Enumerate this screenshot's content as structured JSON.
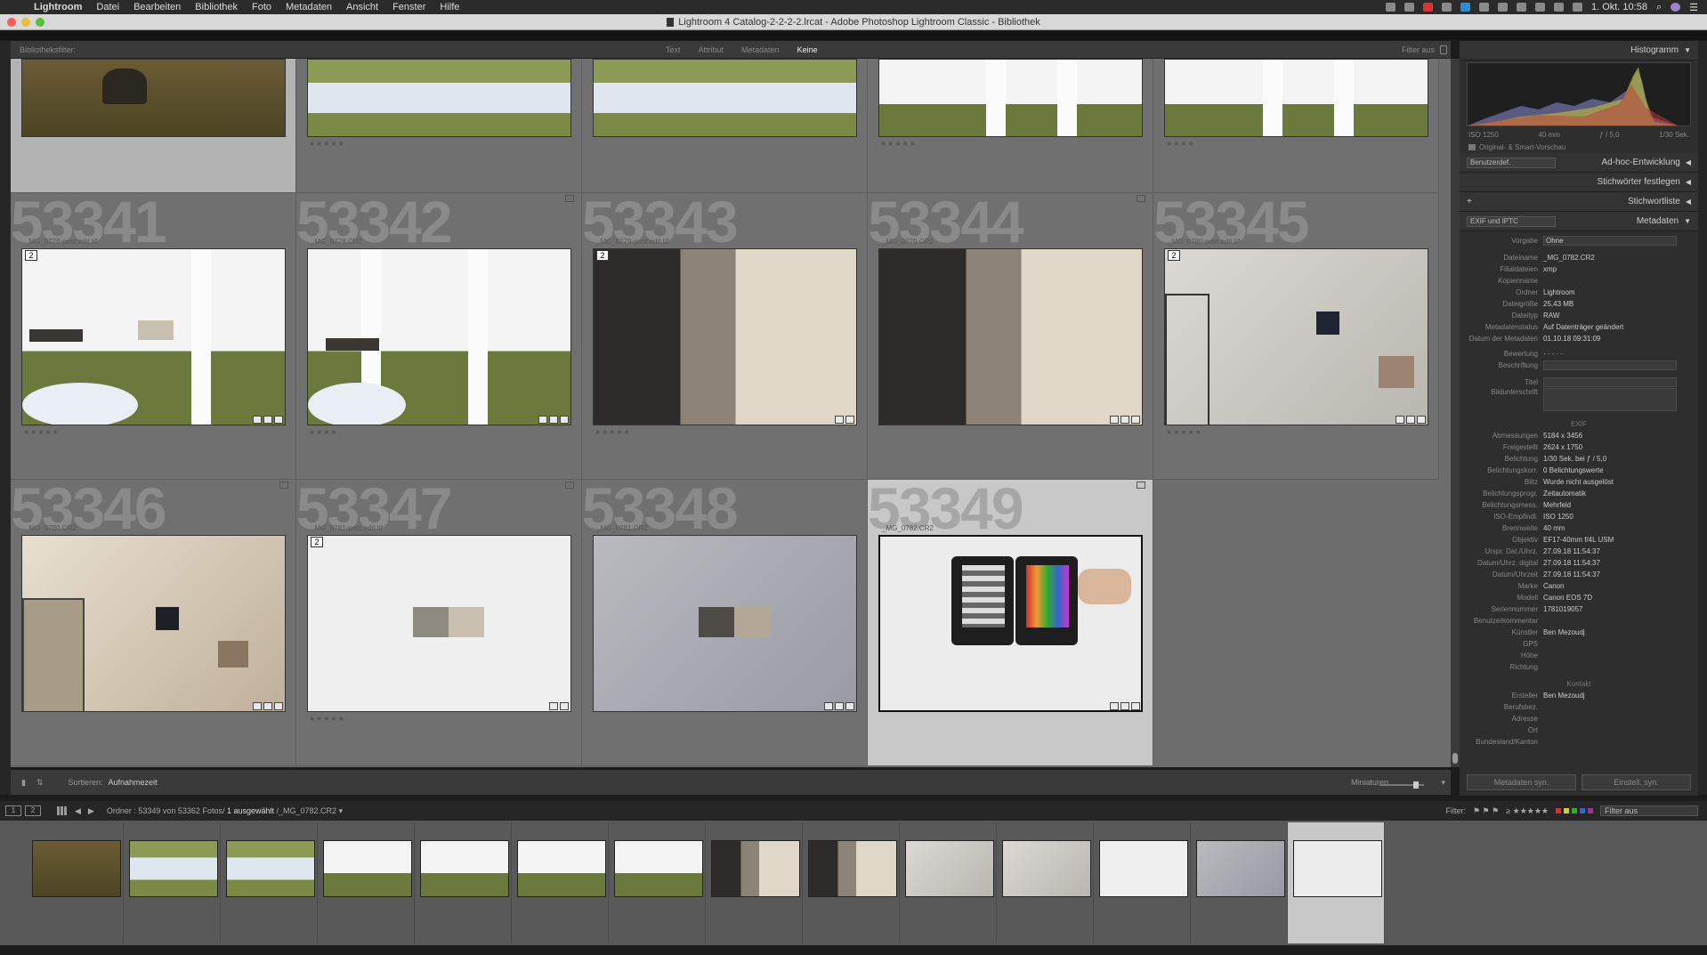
{
  "menubar": {
    "items": [
      "Lightroom",
      "Datei",
      "Bearbeiten",
      "Bibliothek",
      "Foto",
      "Metadaten",
      "Ansicht",
      "Fenster",
      "Hilfe"
    ],
    "clock": "1. Okt. 10:58"
  },
  "window": {
    "title": "Lightroom 4 Catalog-2-2-2-2.lrcat - Adobe Photoshop Lightroom Classic - Bibliothek"
  },
  "filterbar": {
    "label": "Bibliotheksfilter:",
    "options": [
      "Text",
      "Attribut",
      "Metadaten",
      "Keine"
    ],
    "active": "Keine",
    "right": "Filter aus"
  },
  "grid": {
    "top_row_stars": [
      "★★★★★",
      "",
      "★★★★★",
      "★★★★"
    ],
    "cells": [
      {
        "num": "53341",
        "file": "_MG_0778-post.edit.tif",
        "stars": "★★★★★",
        "stack": "2"
      },
      {
        "num": "53342",
        "file": "_MG_0778.CR2",
        "stars": "★★★★",
        "stack": ""
      },
      {
        "num": "53343",
        "file": "_MG_0779-post.edit.tif",
        "stars": "★★★★★",
        "stack": "2"
      },
      {
        "num": "53344",
        "file": "_MG_0779.CR2",
        "stars": "",
        "stack": ""
      },
      {
        "num": "53345",
        "file": "_MG_0780-post.edit.tif",
        "stars": "★★★★★",
        "stack": "2"
      },
      {
        "num": "53346",
        "file": "_MG_0780.CR2",
        "stars": "",
        "stack": ""
      },
      {
        "num": "53347",
        "file": "_MG_0781-post.edit.tif",
        "stars": "★★★★★",
        "stack": "2"
      },
      {
        "num": "53348",
        "file": "_MG_0781.CR2",
        "stars": "",
        "stack": ""
      },
      {
        "num": "53349",
        "file": "_MG_0782.CR2",
        "stars": "",
        "stack": ""
      }
    ]
  },
  "toolbar": {
    "sort_label": "Sortieren:",
    "sort_value": "Aufnahmezeit",
    "thumbs_label": "Miniaturen"
  },
  "right_panel": {
    "histogram": "Histogramm",
    "hist_info": [
      "ISO 1250",
      "40 mm",
      "ƒ / 5,0",
      "1/30 Sek."
    ],
    "smart_preview": "Original- & Smart-Vorschau",
    "preset_select": "Benutzerdef.",
    "adhoc": "Ad-hoc-Entwicklung",
    "keywords": "Stichwörter festlegen",
    "keywordlist": "Stichwortliste",
    "meta_select": "EXIF und IPTC",
    "metadata": "Metadaten",
    "preset_label": "Vorgabe",
    "preset_value": "Ohne",
    "rows": [
      {
        "k": "Dateiname",
        "v": "_MG_0782.CR2"
      },
      {
        "k": "Filialdateien",
        "v": "xmp"
      },
      {
        "k": "Kopienname",
        "v": ""
      },
      {
        "k": "Ordner",
        "v": "Lightroom"
      },
      {
        "k": "Dateigröße",
        "v": "25,43 MB"
      },
      {
        "k": "Dateityp",
        "v": "RAW"
      },
      {
        "k": "Metadatenstatus",
        "v": "Auf Datenträger geändert"
      },
      {
        "k": "Datum der Metadaten",
        "v": "01.10.18 09:31:09"
      }
    ],
    "rating_label": "Bewertung",
    "rating_value": "· · · · ·",
    "label_label": "Beschriftung",
    "title_label": "Titel",
    "caption_label": "Bildunterschrift",
    "exif_header": "EXIF",
    "exif_rows": [
      {
        "k": "Abmessungen",
        "v": "5184 x 3456"
      },
      {
        "k": "Freigestellt",
        "v": "2624 x 1750"
      },
      {
        "k": "Belichtung",
        "v": "1/30 Sek. bei ƒ / 5,0"
      },
      {
        "k": "Belichtungskorr.",
        "v": "0 Belichtungswerte"
      },
      {
        "k": "Blitz",
        "v": "Wurde nicht ausgelöst"
      },
      {
        "k": "Belichtungsprogr.",
        "v": "Zeitautomatik"
      },
      {
        "k": "Belichtungsmess.",
        "v": "Mehrfeld"
      },
      {
        "k": "ISO-Empfindl.",
        "v": "ISO 1250"
      },
      {
        "k": "Brennweite",
        "v": "40 mm"
      },
      {
        "k": "Objektiv",
        "v": "EF17-40mm f/4L USM"
      },
      {
        "k": "Urspr. Dat./Uhrz.",
        "v": "27.09.18 11:54:37"
      },
      {
        "k": "Datum/Uhrz. digital",
        "v": "27.09.18 11:54:37"
      },
      {
        "k": "Datum/Uhrzeit",
        "v": "27.09.18 11:54:37"
      },
      {
        "k": "Marke",
        "v": "Canon"
      },
      {
        "k": "Modell",
        "v": "Canon EOS 7D"
      },
      {
        "k": "Seriennummer",
        "v": "1781019057"
      },
      {
        "k": "Benutzerkommentar",
        "v": ""
      },
      {
        "k": "Künstler",
        "v": "Ben Mezoudj"
      },
      {
        "k": "GPS",
        "v": ""
      },
      {
        "k": "Höhe",
        "v": ""
      },
      {
        "k": "Richtung",
        "v": ""
      }
    ],
    "contact_header": "Kontakt",
    "contact_rows": [
      {
        "k": "Ersteller",
        "v": "Ben Mezoudj"
      },
      {
        "k": "Berufsbez.",
        "v": ""
      },
      {
        "k": "Adresse",
        "v": ""
      },
      {
        "k": "Ort",
        "v": ""
      },
      {
        "k": "Bundesland/Kanton",
        "v": ""
      }
    ],
    "btn_sync_meta": "Metadaten syn.",
    "btn_sync_settings": "Einstell. syn."
  },
  "filmnav": {
    "folder": "Ordner :",
    "count": "53349 von 53362 Fotos/",
    "selected": "1 ausgewählt",
    "file": "/_MG_0782.CR2",
    "filter_label": "Filter:",
    "filter_value": "Filter aus"
  },
  "colors": {
    "accent": "#ffffff",
    "select": "#c8c8c8",
    "panel": "#2e2e2e"
  }
}
